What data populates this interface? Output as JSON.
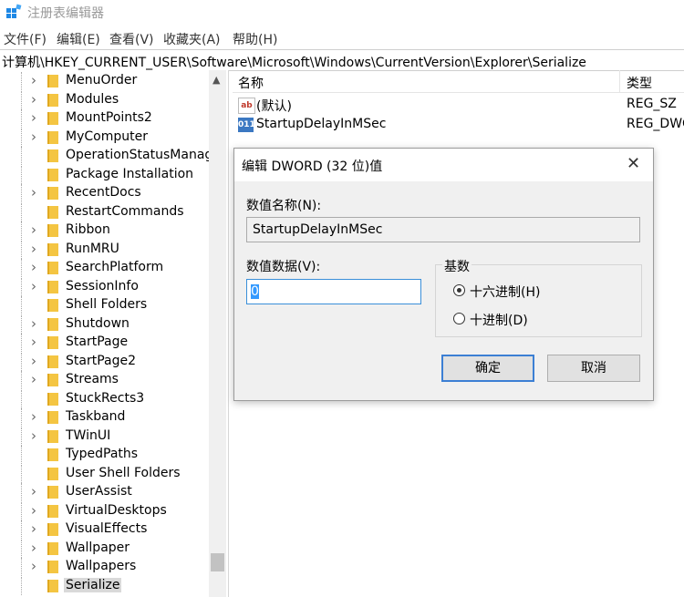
{
  "window": {
    "title": "注册表编辑器"
  },
  "menu": [
    "文件(F)",
    "编辑(E)",
    "查看(V)",
    "收藏夹(A)",
    "帮助(H)"
  ],
  "address": "计算机\\HKEY_CURRENT_USER\\Software\\Microsoft\\Windows\\CurrentVersion\\Explorer\\Serialize",
  "tree": {
    "items": [
      {
        "label": "MenuOrder",
        "expandable": true
      },
      {
        "label": "Modules",
        "expandable": true
      },
      {
        "label": "MountPoints2",
        "expandable": true
      },
      {
        "label": "MyComputer",
        "expandable": true
      },
      {
        "label": "OperationStatusManag",
        "expandable": false
      },
      {
        "label": "Package Installation",
        "expandable": false
      },
      {
        "label": "RecentDocs",
        "expandable": true
      },
      {
        "label": "RestartCommands",
        "expandable": false
      },
      {
        "label": "Ribbon",
        "expandable": true
      },
      {
        "label": "RunMRU",
        "expandable": true
      },
      {
        "label": "SearchPlatform",
        "expandable": true
      },
      {
        "label": "SessionInfo",
        "expandable": true
      },
      {
        "label": "Shell Folders",
        "expandable": false
      },
      {
        "label": "Shutdown",
        "expandable": true
      },
      {
        "label": "StartPage",
        "expandable": true
      },
      {
        "label": "StartPage2",
        "expandable": true
      },
      {
        "label": "Streams",
        "expandable": true
      },
      {
        "label": "StuckRects3",
        "expandable": false
      },
      {
        "label": "Taskband",
        "expandable": true
      },
      {
        "label": "TWinUI",
        "expandable": true
      },
      {
        "label": "TypedPaths",
        "expandable": false
      },
      {
        "label": "User Shell Folders",
        "expandable": false
      },
      {
        "label": "UserAssist",
        "expandable": true
      },
      {
        "label": "VirtualDesktops",
        "expandable": true
      },
      {
        "label": "VisualEffects",
        "expandable": true
      },
      {
        "label": "Wallpaper",
        "expandable": true
      },
      {
        "label": "Wallpapers",
        "expandable": true
      },
      {
        "label": "Serialize",
        "expandable": false,
        "selected": true
      }
    ]
  },
  "list": {
    "col_name": "名称",
    "col_type": "类型",
    "rows": [
      {
        "name": "(默认)",
        "type": "REG_SZ",
        "icon": "string-value-icon"
      },
      {
        "name": "StartupDelayInMSec",
        "type": "REG_DWC",
        "icon": "binary-value-icon"
      }
    ]
  },
  "dialog": {
    "title": "编辑 DWORD (32 位)值",
    "value_name_label": "数值名称(N):",
    "value_name": "StartupDelayInMSec",
    "value_data_label": "数值数据(V):",
    "value_data": "0",
    "base_label": "基数",
    "radio_hex": "十六进制(H)",
    "radio_dec": "十进制(D)",
    "base_selected": "hex",
    "ok": "确定",
    "cancel": "取消"
  }
}
